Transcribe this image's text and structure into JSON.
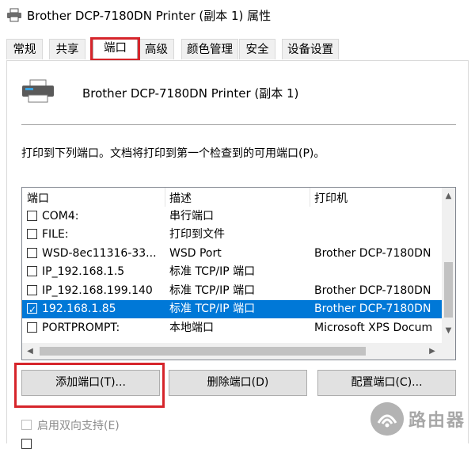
{
  "window": {
    "title": "Brother DCP-7180DN Printer (副本 1) 属性"
  },
  "tabs": [
    {
      "label": "常规",
      "active": false
    },
    {
      "label": "共享",
      "active": false
    },
    {
      "label": "端口",
      "active": true
    },
    {
      "label": "高级",
      "active": false
    },
    {
      "label": "颜色管理",
      "active": false
    },
    {
      "label": "安全",
      "active": false
    },
    {
      "label": "设备设置",
      "active": false
    }
  ],
  "printer": {
    "name": "Brother DCP-7180DN Printer (副本 1)"
  },
  "instruction": "打印到下列端口。文档将打印到第一个检查到的可用端口(P)。",
  "port_list": {
    "headers": [
      "端口",
      "描述",
      "打印机"
    ],
    "rows": [
      {
        "port": "COM4:",
        "description": "串行端口",
        "printer": "",
        "checked": false,
        "selected": false
      },
      {
        "port": "FILE:",
        "description": "打印到文件",
        "printer": "",
        "checked": false,
        "selected": false
      },
      {
        "port": "WSD-8ec11316-33...",
        "description": "WSD Port",
        "printer": "Brother DCP-7180DN",
        "checked": false,
        "selected": false
      },
      {
        "port": "IP_192.168.1.5",
        "description": "标准 TCP/IP 端口",
        "printer": "",
        "checked": false,
        "selected": false
      },
      {
        "port": "IP_192.168.199.140",
        "description": "标准 TCP/IP 端口",
        "printer": "Brother DCP-7180DN",
        "checked": false,
        "selected": false
      },
      {
        "port": "192.168.1.85",
        "description": "标准 TCP/IP 端口",
        "printer": "Brother DCP-7180DN",
        "checked": true,
        "selected": true
      },
      {
        "port": "PORTPROMPT:",
        "description": "本地端口",
        "printer": "Microsoft XPS Docum",
        "checked": false,
        "selected": false
      }
    ]
  },
  "buttons": {
    "add": "添加端口(T)...",
    "delete": "删除端口(D)",
    "configure": "配置端口(C)..."
  },
  "options": {
    "bidirectional": "启用双向支持(E)"
  },
  "watermark": {
    "text": "路由器"
  },
  "colors": {
    "selection": "#0078d7",
    "highlight": "#d6252b"
  }
}
